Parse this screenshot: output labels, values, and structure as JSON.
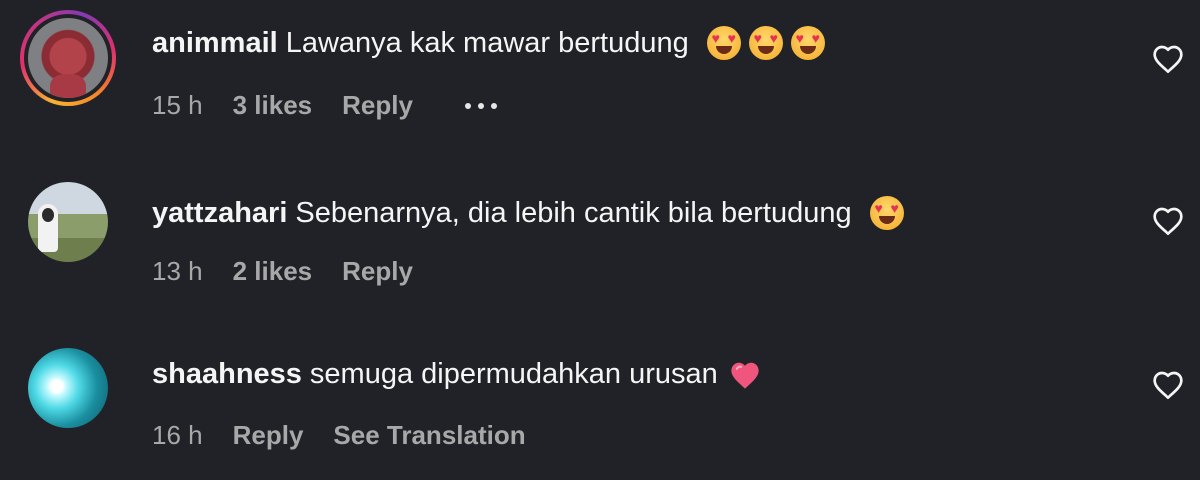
{
  "comments": [
    {
      "username": "animmail",
      "text": "Lawanya kak mawar bertudung",
      "emojis": [
        "heart-eyes",
        "heart-eyes",
        "heart-eyes"
      ],
      "time": "15 h",
      "likes": "3 likes",
      "reply": "Reply",
      "has_story_ring": true
    },
    {
      "username": "yattzahari",
      "text": "Sebenarnya, dia lebih cantik bila bertudung",
      "emojis": [
        "heart-eyes"
      ],
      "time": "13 h",
      "likes": "2 likes",
      "reply": "Reply"
    },
    {
      "username": "shaahness",
      "text": "semuga dipermudahkan urusan",
      "emojis": [
        "pink-heart"
      ],
      "time": "16 h",
      "reply": "Reply",
      "see_translation": "See Translation"
    }
  ],
  "icons": {
    "like": "heart-outline-icon",
    "more": "more-options-icon"
  },
  "colors": {
    "background": "#212227",
    "text": "#f5f5f5",
    "meta": "#a8a8a8",
    "pink_heart": "#f0567d"
  }
}
